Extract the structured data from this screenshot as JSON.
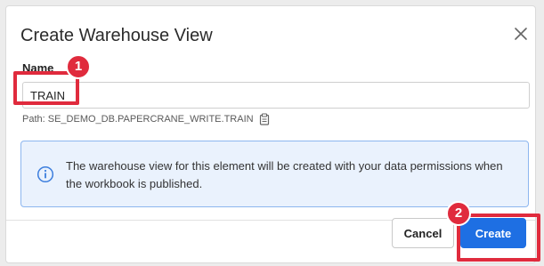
{
  "dialog": {
    "title": "Create Warehouse View",
    "name_label": "Name",
    "name_value": "TRAIN",
    "path_text": "Path: SE_DEMO_DB.PAPERCRANE_WRITE.TRAIN",
    "info_text": "The warehouse view for this element will be created with your data permissions when the workbook is published.",
    "cancel_label": "Cancel",
    "create_label": "Create"
  },
  "annotations": {
    "badge_1": "1",
    "badge_2": "2",
    "color": "#e02b3d"
  },
  "colors": {
    "primary": "#1e6fe3",
    "info_bg": "#eaf2fd",
    "info_border": "#8db6ef"
  }
}
